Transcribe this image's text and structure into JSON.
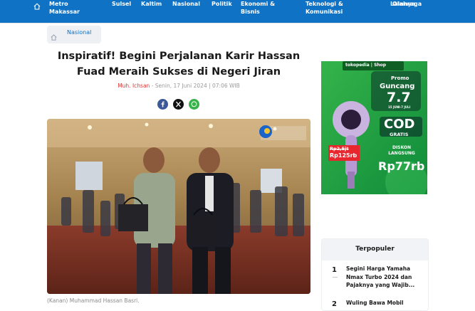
{
  "nav": {
    "items": [
      {
        "label": "Metro Makassar"
      },
      {
        "label": "Sulsel"
      },
      {
        "label": "Kaltim"
      },
      {
        "label": "Nasional"
      },
      {
        "label": "Politik"
      },
      {
        "label": "Ekonomi & Bisnis"
      },
      {
        "label": "Teknologi & Komunikasi"
      },
      {
        "label": "Olahraga"
      },
      {
        "label": "Lainnya"
      }
    ]
  },
  "breadcrumb": {
    "category": "Nasional"
  },
  "article": {
    "title": "Inspiratif! Begini Perjalanan Karir Hassan Fuad Meraih Sukses di Negeri Jiran",
    "author": "Muh. Ichsan",
    "date": "- Senin, 17 Juni 2024 | 07:06 WIB",
    "caption": "(Kanan) Muhammad Hassan Basri."
  },
  "share": {
    "icons": [
      "facebook-icon",
      "x-icon",
      "whatsapp-icon"
    ]
  },
  "ad": {
    "brand": "tokopedia | Shop",
    "promo": "Promo",
    "event": "Guncang",
    "event_date": "7.7",
    "period": "15 JUNI-7 JULI",
    "cod": "COD",
    "gratis": "GRATIS",
    "old_price": "Rp2,5jt",
    "new_price": "Rp125rb",
    "discount": "DISKON LANGSUNG",
    "discount_value": "Rp77rb"
  },
  "popular": {
    "heading": "Terpopuler",
    "items": [
      {
        "num": "1",
        "title": "Segini Harga Yamaha Nmax Turbo 2024 dan Pajaknya yang Wajib..."
      },
      {
        "num": "2",
        "title": "Wuling Bawa Mobil"
      }
    ]
  }
}
